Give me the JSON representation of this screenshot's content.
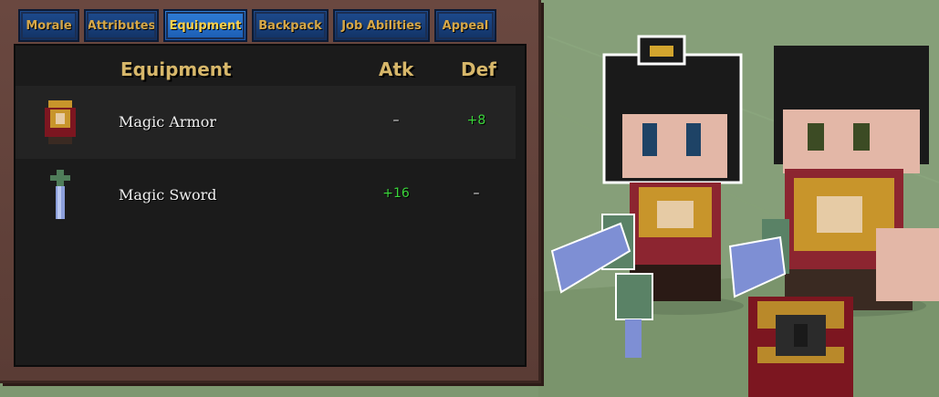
{
  "tabs": [
    {
      "label": "Morale",
      "active": false
    },
    {
      "label": "Attributes",
      "active": false
    },
    {
      "label": "Equipment",
      "active": true
    },
    {
      "label": "Backpack",
      "active": false
    },
    {
      "label": "Job Abilities",
      "active": false
    },
    {
      "label": "Appeal",
      "active": false
    }
  ],
  "table": {
    "headers": {
      "name": "Equipment",
      "atk": "Atk",
      "def": "Def"
    },
    "rows": [
      {
        "icon": "magic-armor-icon",
        "name": "Magic Armor",
        "atk": "–",
        "def": "+8"
      },
      {
        "icon": "magic-sword-icon",
        "name": "Magic Sword",
        "atk": "+16",
        "def": "–"
      }
    ]
  },
  "colors": {
    "panel_brown": "#5a3c35",
    "tab_blue": "#1e4c8f",
    "tab_active_blue": "#2f7ed8",
    "tab_text_gold": "#d7a848",
    "header_gold": "#d7b76a",
    "bonus_green": "#3bd53b",
    "ground_green": "#7f9a71"
  }
}
